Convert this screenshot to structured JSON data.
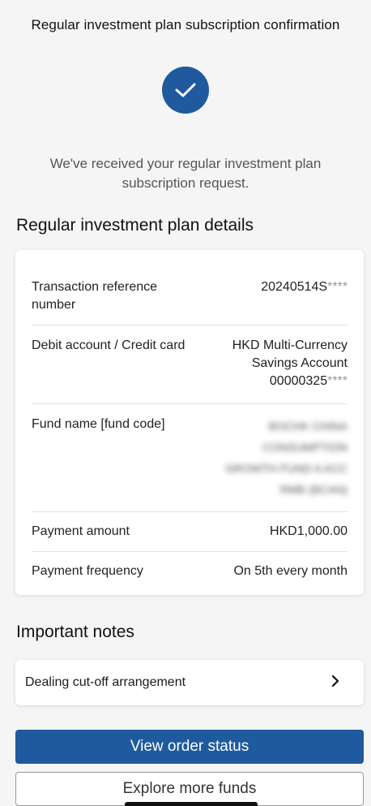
{
  "header": {
    "title": "Regular investment plan subscription confirmation"
  },
  "status": {
    "icon": "check-circle-icon",
    "message": "We've received your regular investment plan subscription request."
  },
  "details": {
    "title": "Regular investment plan details",
    "transaction": {
      "label": "Transaction reference number",
      "value": "20240514S",
      "mask": "****"
    },
    "debit": {
      "label": "Debit account / Credit card",
      "value_line1": "HKD Multi-Currency",
      "value_line2": "Savings Account",
      "value_line3": "00000325",
      "mask": "****"
    },
    "fund": {
      "label": "Fund name [fund code]",
      "value_blurred": "BOCHK CHINA CONSUMPTION GROWTH FUND A ACC RMB (BCAN)"
    },
    "payment_amount": {
      "label": "Payment amount",
      "value": "HKD1,000.00"
    },
    "payment_frequency": {
      "label": "Payment frequency",
      "value": "On 5th every month"
    }
  },
  "notes": {
    "title": "Important notes",
    "dealing": {
      "label": "Dealing cut-off arrangement",
      "icon": "chevron-right-icon"
    }
  },
  "actions": {
    "view_order_status": "View order status",
    "explore_more_funds": "Explore more funds"
  },
  "colors": {
    "accent": "#1f5a9e"
  }
}
